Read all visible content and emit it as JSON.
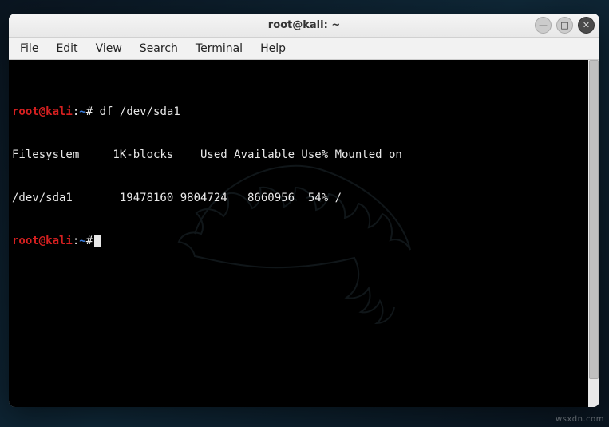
{
  "window": {
    "title": "root@kali: ~"
  },
  "win_buttons": {
    "minimize": "—",
    "maximize": "□",
    "close": "✕"
  },
  "menubar": {
    "file": "File",
    "edit": "Edit",
    "view": "View",
    "search": "Search",
    "terminal": "Terminal",
    "help": "Help"
  },
  "prompt": {
    "user_host": "root@kali",
    "separator": ":",
    "path": "~",
    "symbol": "#"
  },
  "command": "df /dev/sda1",
  "output": {
    "header": "Filesystem     1K-blocks    Used Available Use% Mounted on",
    "row": "/dev/sda1       19478160 9804724   8660956  54% /"
  },
  "watermark": "wsxdn.com"
}
